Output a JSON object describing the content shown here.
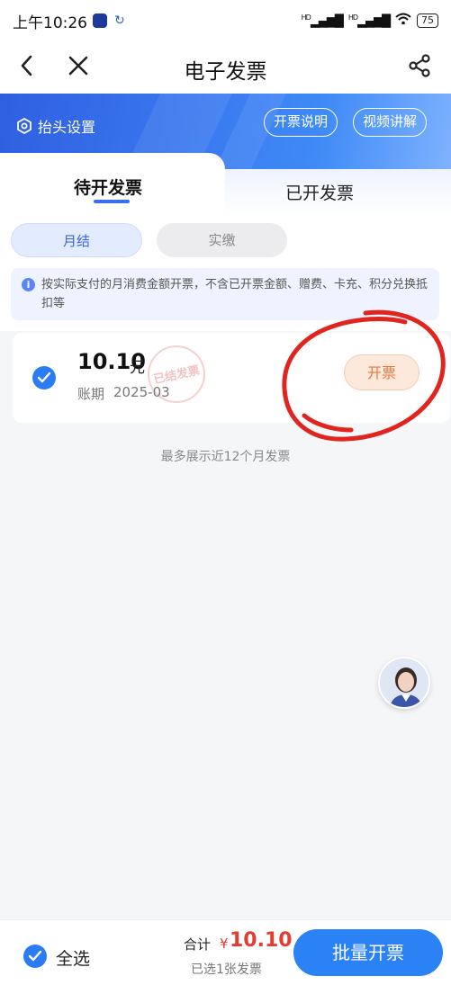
{
  "status_bar": {
    "time": "上午10:26",
    "battery": "75",
    "signal_1": "HD",
    "signal_2": "HD"
  },
  "nav": {
    "title": "电子发票",
    "back_icon": "chevron-left-icon",
    "close_icon": "close-icon",
    "share_icon": "share-icon"
  },
  "header": {
    "setting_label": "抬头设置",
    "explain_label": "开票说明",
    "video_label": "视频讲解"
  },
  "tabs": [
    {
      "label": "待开发票",
      "active": true
    },
    {
      "label": "已开发票",
      "active": false
    }
  ],
  "filters": [
    {
      "label": "月结",
      "active": true
    },
    {
      "label": "实缴",
      "active": false
    }
  ],
  "notice": {
    "text": "按实际支付的月消费金额开票，不含已开票金额、赠费、卡充、积分兑换抵扣等"
  },
  "bill": {
    "amount": "10.10",
    "unit": "元",
    "period_label": "账期",
    "period_value": "2025-03",
    "stamp_text": "已结发票",
    "action_label": "开票",
    "checked": true
  },
  "footer_note": "最多展示近12个月发票",
  "bottom": {
    "select_all_label": "全选",
    "total_label": "合计",
    "currency": "¥",
    "total_value": "10.10",
    "selected_count": "已选1张发票",
    "batch_label": "批量开票"
  },
  "colors": {
    "accent": "#2a82f4",
    "banner": "#3a7af0",
    "price": "#e33d33",
    "invoice_btn_text": "#e8763b"
  }
}
